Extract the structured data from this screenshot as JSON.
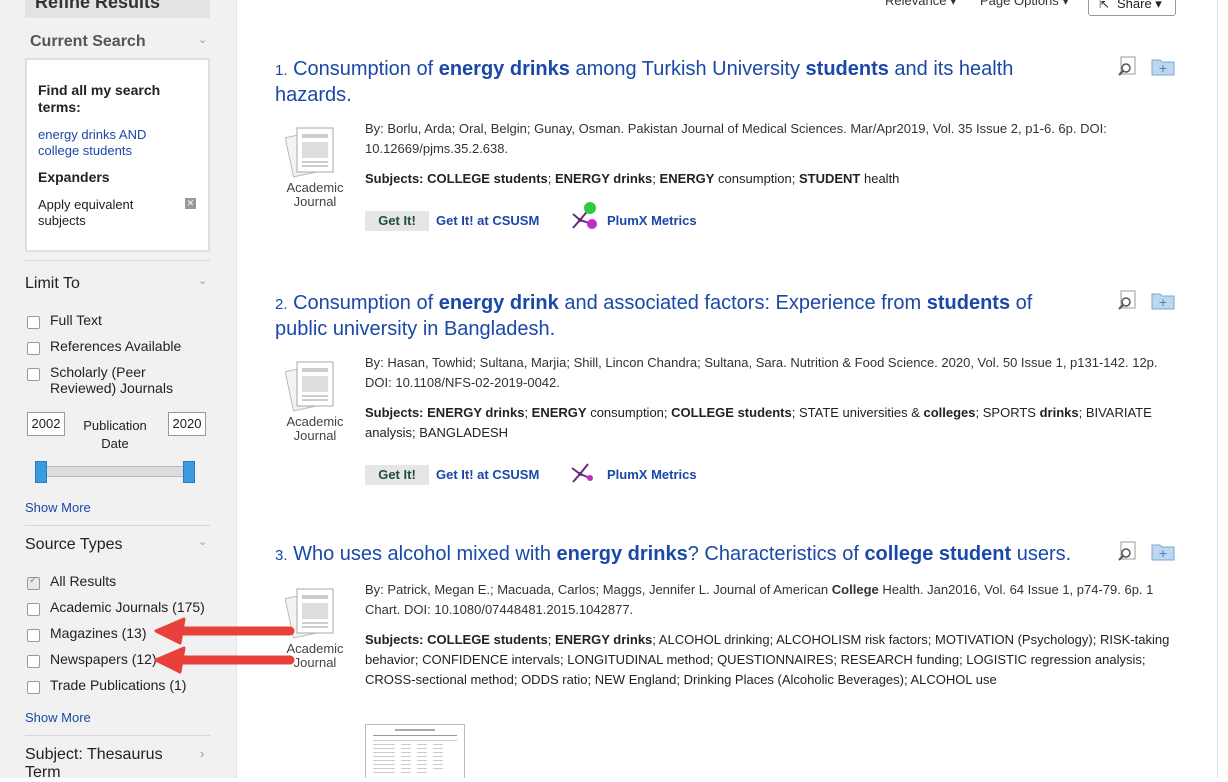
{
  "sidebar": {
    "refine_title": "Refine Results",
    "current_search": {
      "title": "Current Search",
      "find_all": "Find all my search terms:",
      "search_terms": "energy drinks AND college students",
      "expanders_title": "Expanders",
      "expander_item": "Apply equivalent subjects"
    },
    "limit_to": {
      "title": "Limit To",
      "items": [
        "Full Text",
        "References Available",
        "Scholarly (Peer Reviewed) Journals"
      ],
      "year_from": "2002",
      "year_to": "2020",
      "pub_date_label": "Publication Date",
      "show_more": "Show More"
    },
    "source_types": {
      "title": "Source Types",
      "items": [
        {
          "label": "All Results",
          "checked": true
        },
        {
          "label": "Academic Journals (175)",
          "checked": false
        },
        {
          "label": "Magazines (13)",
          "checked": false
        },
        {
          "label": "Newspapers (12)",
          "checked": false
        },
        {
          "label": "Trade Publications (1)",
          "checked": false
        }
      ],
      "show_more": "Show More"
    },
    "subject_thesaurus": "Subject: Thesaurus Term"
  },
  "toolbar": {
    "relevance": "Relevance ▾",
    "page_options": "Page Options ▾",
    "share": "Share ▾"
  },
  "results": [
    {
      "num": "1.",
      "title_parts": [
        {
          "t": "Consumption of ",
          "b": false
        },
        {
          "t": "energy drinks",
          "b": true
        },
        {
          "t": " among Turkish University ",
          "b": false
        },
        {
          "t": "students",
          "b": true
        },
        {
          "t": " and its health hazards.",
          "b": false
        }
      ],
      "meta": "By: Borlu, Arda; Oral, Belgin; Gunay, Osman. Pakistan Journal of Medical Sciences. Mar/Apr2019, Vol. 35 Issue 2, p1-6. 6p. DOI: 10.12669/pjms.35.2.638.",
      "subjects_label": "Subjects:",
      "subjects_parts": [
        {
          "t": "COLLEGE students",
          "b": true
        },
        {
          "t": "; ",
          "b": false
        },
        {
          "t": "ENERGY drinks",
          "b": true
        },
        {
          "t": "; ",
          "b": false
        },
        {
          "t": "ENERGY",
          "b": true
        },
        {
          "t": " consumption; ",
          "b": false
        },
        {
          "t": "STUDENT",
          "b": true
        },
        {
          "t": " health",
          "b": false
        }
      ],
      "type": "Academic Journal",
      "getit": "Get It!",
      "getit_csusm": "Get It! at CSUSM",
      "plumx": "PlumX Metrics"
    },
    {
      "num": "2.",
      "title_parts": [
        {
          "t": "Consumption of ",
          "b": false
        },
        {
          "t": "energy drink",
          "b": true
        },
        {
          "t": " and associated factors: Experience from ",
          "b": false
        },
        {
          "t": "students",
          "b": true
        },
        {
          "t": " of public university in Bangladesh.",
          "b": false
        }
      ],
      "meta": "By: Hasan, Towhid; Sultana, Marjia; Shill, Lincon Chandra; Sultana, Sara. Nutrition & Food Science. 2020, Vol. 50 Issue 1, p131-142. 12p. DOI: 10.1108/NFS-02-2019-0042.",
      "subjects_label": "Subjects:",
      "subjects_parts": [
        {
          "t": "ENERGY drinks",
          "b": true
        },
        {
          "t": "; ",
          "b": false
        },
        {
          "t": "ENERGY",
          "b": true
        },
        {
          "t": " consumption; ",
          "b": false
        },
        {
          "t": "COLLEGE students",
          "b": true
        },
        {
          "t": "; STATE universities & ",
          "b": false
        },
        {
          "t": "colleges",
          "b": true
        },
        {
          "t": "; SPORTS ",
          "b": false
        },
        {
          "t": "drinks",
          "b": true
        },
        {
          "t": "; BIVARIATE analysis; BANGLADESH",
          "b": false
        }
      ],
      "type": "Academic Journal",
      "getit": "Get It!",
      "getit_csusm": "Get It! at CSUSM",
      "plumx": "PlumX Metrics"
    },
    {
      "num": "3.",
      "title_parts": [
        {
          "t": "Who uses alcohol mixed with ",
          "b": false
        },
        {
          "t": "energy drinks",
          "b": true
        },
        {
          "t": "? Characteristics of ",
          "b": false
        },
        {
          "t": "college student",
          "b": true
        },
        {
          "t": " users.",
          "b": false
        }
      ],
      "meta_parts": [
        {
          "t": "By: Patrick, Megan E.; Macuada, Carlos; Maggs, Jennifer L. Journal of American ",
          "b": false
        },
        {
          "t": "College",
          "b": true
        },
        {
          "t": " Health. Jan2016, Vol. 64 Issue 1, p74-79. 6p. 1 Chart. DOI: 10.1080/07448481.2015.1042877.",
          "b": false
        }
      ],
      "subjects_label": "Subjects:",
      "subjects_parts": [
        {
          "t": "COLLEGE students",
          "b": true
        },
        {
          "t": "; ",
          "b": false
        },
        {
          "t": "ENERGY drinks",
          "b": true
        },
        {
          "t": "; ALCOHOL drinking; ALCOHOLISM risk factors; MOTIVATION (Psychology); RISK-taking behavior; CONFIDENCE intervals; LONGITUDINAL method; QUESTIONNAIRES; RESEARCH funding; LOGISTIC regression analysis; CROSS-sectional method; ODDS ratio; NEW England; Drinking Places (Alcoholic Beverages); ALCOHOL use",
          "b": false
        }
      ],
      "type": "Academic Journal"
    }
  ],
  "colors": {
    "link": "#1a48a8",
    "arrow": "#e8403a"
  }
}
